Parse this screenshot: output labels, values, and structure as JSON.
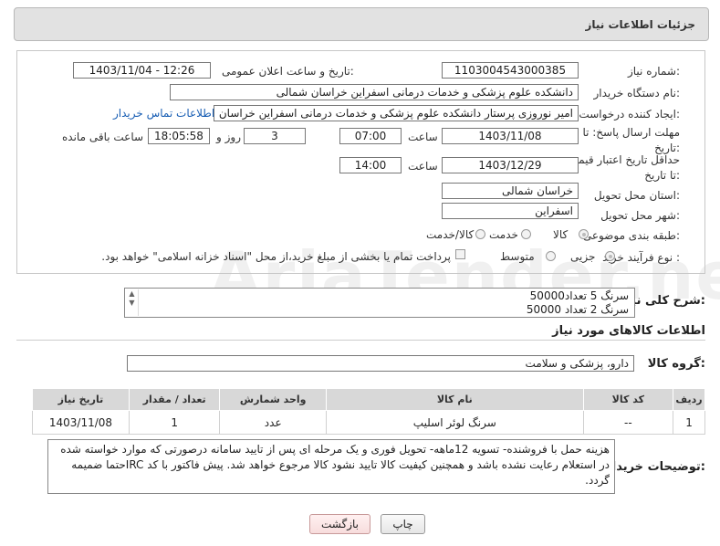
{
  "header": {
    "title": "جزئیات اطلاعات نیاز"
  },
  "form": {
    "need_number_label": "شماره نیاز:",
    "need_number": "1103004543000385",
    "announce_label": "تاریخ و ساعت اعلان عمومی:",
    "announce_value": "1403/11/04 - 12:26",
    "buyer_org_label": "نام دستگاه خریدار:",
    "buyer_org": "دانشکده علوم پزشکی و خدمات درمانی اسفراین خراسان شمالی",
    "creator_label": "ایجاد کننده درخواست:",
    "creator": "امیر  نوروزی  پرستار  دانشکده علوم پزشکی و خدمات درمانی اسفراین خراسان",
    "contact_link": "اطلاعات تماس خریدار",
    "deadline_label": "مهلت ارسال پاسخ: تا تاریخ:",
    "deadline_date": "1403/11/08",
    "time_label": "ساعت",
    "deadline_time": "07:00",
    "days_value": "3",
    "days_label": "روز و",
    "remaining_time": "18:05:58",
    "remaining_label": "ساعت باقی مانده",
    "validity_label": "حداقل تاریخ اعتبار قیمت: تا تاریخ:",
    "validity_date": "1403/12/29",
    "validity_time": "14:00",
    "province_label": "استان محل تحویل:",
    "province": "خراسان شمالی",
    "city_label": "شهر محل تحویل:",
    "city": "اسفراین",
    "category_label": "طبقه بندی موضوعی:",
    "category_options": [
      "کالا",
      "خدمت",
      "کالا/خدمت"
    ],
    "process_label": "نوع فرآیند خرید :",
    "process_options": [
      "جزیی",
      "متوسط"
    ],
    "payment_note": "پرداخت تمام یا بخشی از مبلغ خرید،از محل \"اسناد خزانه اسلامی\" خواهد بود."
  },
  "description": {
    "label": "شرح کلی نیاز:",
    "lines": [
      "سرنگ 5 تعداد50000",
      "سرنگ 2 تعداد 50000"
    ]
  },
  "goods": {
    "section_title": "اطلاعات کالاهای مورد نیاز",
    "group_label": "گروه کالا:",
    "group_value": "دارو، پزشکی و سلامت",
    "columns": [
      "ردیف",
      "کد کالا",
      "نام کالا",
      "واحد شمارش",
      "تعداد / مقدار",
      "تاریخ نیاز"
    ],
    "rows": [
      {
        "row": "1",
        "code": "--",
        "name": "سرنگ لوئر اسلیپ",
        "unit": "عدد",
        "qty": "1",
        "date": "1403/11/08"
      }
    ]
  },
  "buyer_notes": {
    "label": "توضیحات خریدار:",
    "text": "هزینه حمل با فروشنده- تسویه 12ماهه- تحویل فوری و یک مرحله ای پس از تایید سامانه درصورتی که موارد خواسته شده در استعلام رعایت نشده باشد و همچنین کیفیت کالا تایید نشود کالا مرجوع خواهد شد. پیش فاکتور با کد IRCحتما ضمیمه گردد."
  },
  "buttons": {
    "print": "چاپ",
    "back": "بازگشت"
  },
  "watermark": "AriaTender.net"
}
